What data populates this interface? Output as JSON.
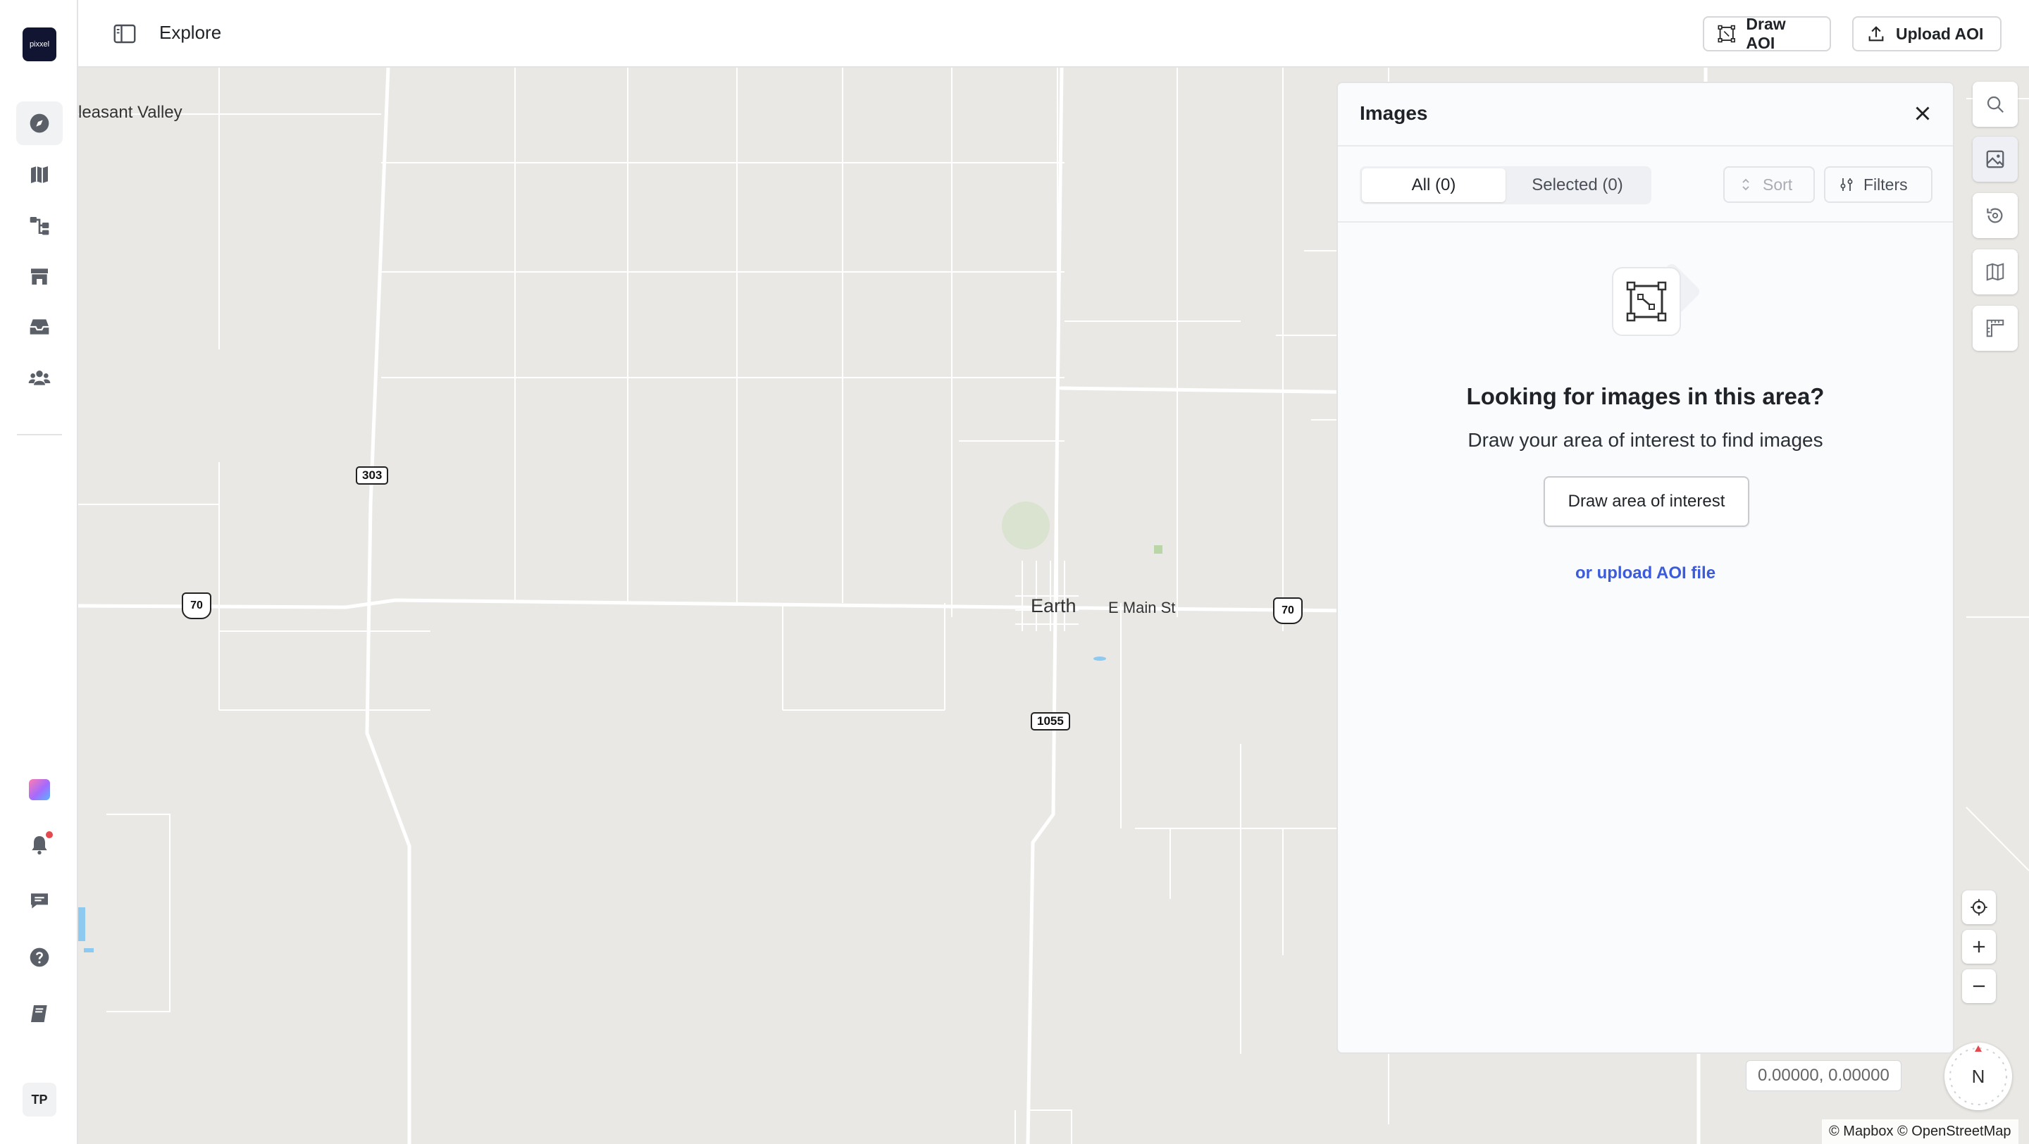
{
  "app": {
    "logo_text": "pixxel",
    "page_title": "Explore",
    "user_initials": "TP"
  },
  "left_nav": {
    "items": [
      {
        "name": "explore",
        "icon": "compass-icon",
        "active": true
      },
      {
        "name": "maps",
        "icon": "map-icon"
      },
      {
        "name": "workflows",
        "icon": "workflow-icon"
      },
      {
        "name": "store",
        "icon": "store-icon"
      },
      {
        "name": "library",
        "icon": "inbox-icon"
      },
      {
        "name": "team",
        "icon": "users-icon"
      }
    ],
    "bottom_items": [
      {
        "name": "apps",
        "icon": "gradient-app-icon"
      },
      {
        "name": "notifications",
        "icon": "bell-icon",
        "has_unread": true
      },
      {
        "name": "feedback",
        "icon": "chat-icon"
      },
      {
        "name": "help",
        "icon": "help-icon"
      },
      {
        "name": "docs",
        "icon": "book-icon"
      }
    ]
  },
  "toolbar": {
    "draw_aoi_label": "Draw AOI",
    "upload_aoi_label": "Upload AOI"
  },
  "map": {
    "labels": {
      "pleasant_valley": "leasant Valley",
      "earth": "Earth",
      "e_main_st": "E Main St"
    },
    "shields": {
      "route_303": "303",
      "route_70_west": "70",
      "route_70_east": "70",
      "route_1055": "1055"
    },
    "coordinates": "0.00000, 0.00000",
    "compass_label": "N",
    "attribution": "© Mapbox © OpenStreetMap",
    "colors": {
      "land": "#e9e8e4",
      "road": "#ffffff",
      "water": "#8ec9ef",
      "park": "#cfe3c2"
    }
  },
  "right_tools": [
    {
      "name": "search",
      "icon": "search-icon"
    },
    {
      "name": "images",
      "icon": "image-icon",
      "active": true
    },
    {
      "name": "history",
      "icon": "history-icon"
    },
    {
      "name": "layers",
      "icon": "map-layers-icon"
    },
    {
      "name": "measure",
      "icon": "ruler-icon"
    }
  ],
  "images_panel": {
    "title": "Images",
    "tabs": {
      "all_label": "All (0)",
      "selected_label": "Selected (0)"
    },
    "sort_label": "Sort",
    "filters_label": "Filters",
    "empty_state": {
      "title": "Looking for images in this area?",
      "subtitle": "Draw your area of interest to find images",
      "button_label": "Draw area of interest",
      "link_label": "or upload AOI file"
    }
  }
}
